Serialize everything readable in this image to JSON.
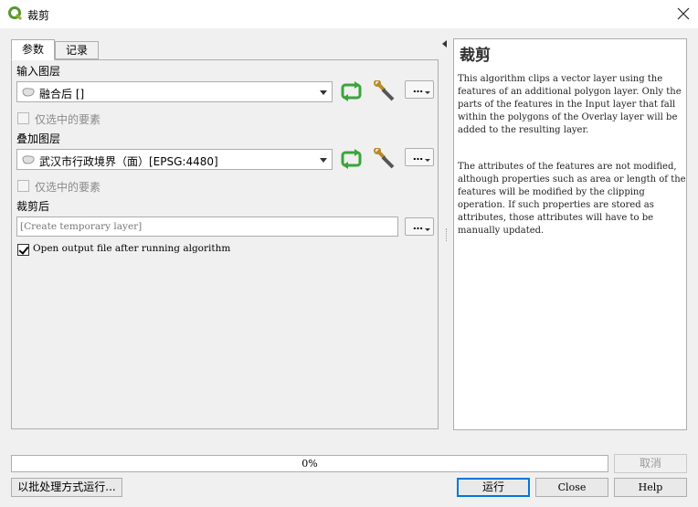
{
  "window": {
    "title": "裁剪",
    "app_icon": "qgis-icon",
    "close_icon": "close-icon"
  },
  "tabs": [
    {
      "label": "参数",
      "active": true
    },
    {
      "label": "记录",
      "active": false
    }
  ],
  "params": {
    "input_layer": {
      "label": "输入图层",
      "value": "融合后 []",
      "selected_only": "仅选中的要素",
      "selected_only_checked": false
    },
    "overlay_layer": {
      "label": "叠加图层",
      "value": "武汉市行政境界（面）[EPSG:4480]",
      "selected_only": "仅选中的要素",
      "selected_only_checked": false
    },
    "output": {
      "label": "裁剪后",
      "placeholder": "[Create temporary layer]",
      "open_output": "Open output file after running algorithm",
      "open_output_checked": true
    },
    "more_button": "…"
  },
  "help": {
    "title": "裁剪",
    "paragraph1": "This algorithm clips a vector layer using the features of an additional polygon layer. Only the parts of the features in the Input layer that fall within the polygons of the Overlay layer will be added to the resulting layer.",
    "paragraph2": "The attributes of the features are not modified, although properties such as area or length of the features will be modified by the clipping operation. If such properties are stored as attributes, those attributes will have to be manually updated."
  },
  "progress": {
    "value": 0,
    "label": "0%"
  },
  "buttons": {
    "cancel": "取消",
    "batch": "以批处理方式运行...",
    "run": "运行",
    "close": "Close",
    "help": "Help"
  },
  "colors": {
    "accent": "#0078d7",
    "progress": "#06b025",
    "refresh_green": "#3aa53a"
  }
}
